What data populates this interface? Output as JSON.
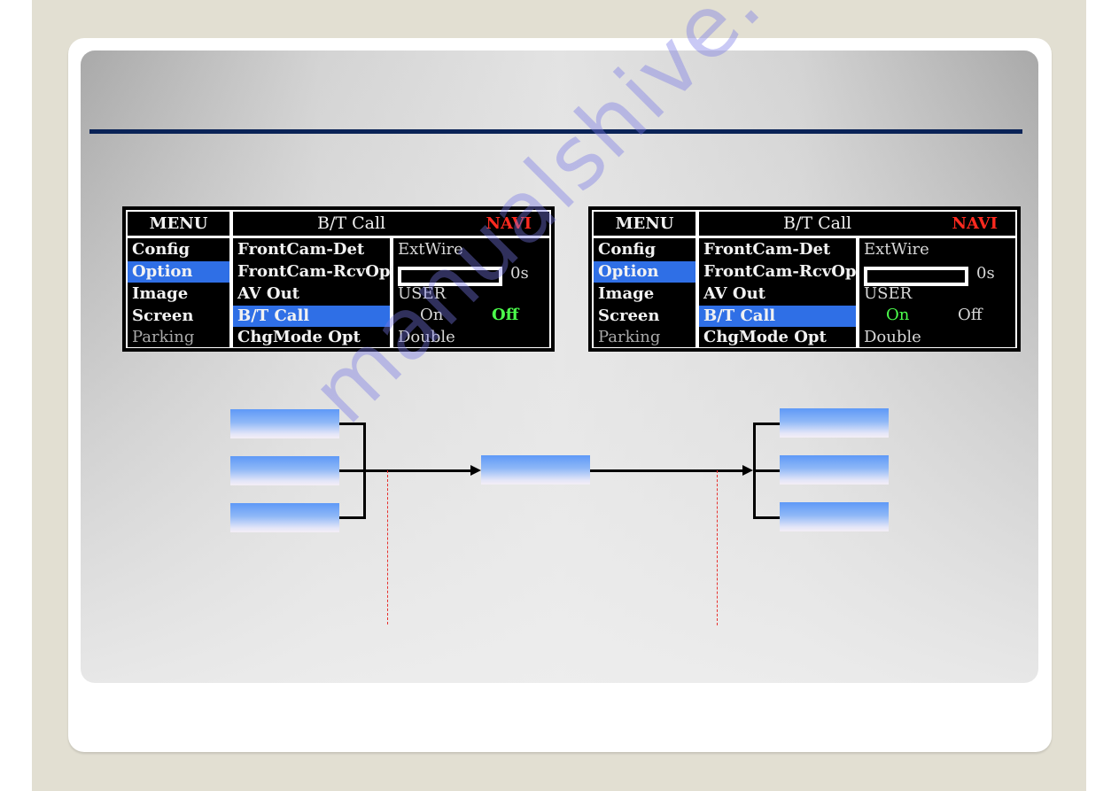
{
  "osd_left": {
    "header": {
      "menu": "MENU",
      "title": "B/T Call",
      "source": "NAVI"
    },
    "menu_items": [
      {
        "label": "Config",
        "state": "normal"
      },
      {
        "label": "Option",
        "state": "selected"
      },
      {
        "label": "Image",
        "state": "normal"
      },
      {
        "label": "Screen",
        "state": "normal"
      },
      {
        "label": "Parking",
        "state": "disabled"
      }
    ],
    "sub_items": [
      {
        "label": "FrontCam-Det",
        "state": "normal"
      },
      {
        "label": "FrontCam-RcvOpt",
        "state": "normal"
      },
      {
        "label": "AV Out",
        "state": "normal"
      },
      {
        "label": "B/T Call",
        "state": "selected"
      },
      {
        "label": "ChgMode Opt",
        "state": "normal"
      }
    ],
    "values": {
      "extwire": "ExtWire",
      "delay_value": "0s",
      "user": "USER",
      "option_on": "On",
      "option_off": "Off",
      "active_option": "Off",
      "double": "Double"
    }
  },
  "osd_right": {
    "header": {
      "menu": "MENU",
      "title": "B/T Call",
      "source": "NAVI"
    },
    "menu_items": [
      {
        "label": "Config",
        "state": "normal"
      },
      {
        "label": "Option",
        "state": "selected"
      },
      {
        "label": "Image",
        "state": "normal"
      },
      {
        "label": "Screen",
        "state": "normal"
      },
      {
        "label": "Parking",
        "state": "disabled"
      }
    ],
    "sub_items": [
      {
        "label": "FrontCam-Det",
        "state": "normal"
      },
      {
        "label": "FrontCam-RcvOpt",
        "state": "normal"
      },
      {
        "label": "AV Out",
        "state": "normal"
      },
      {
        "label": "B/T Call",
        "state": "selected"
      },
      {
        "label": "ChgMode Opt",
        "state": "normal"
      }
    ],
    "values": {
      "extwire": "ExtWire",
      "delay_value": "0s",
      "user": "USER",
      "option_on": "On",
      "option_off": "Off",
      "active_option": "On",
      "double": "Double"
    }
  },
  "diagram": {
    "left_boxes": [
      "",
      "",
      ""
    ],
    "center_box": "",
    "right_boxes": [
      "",
      "",
      ""
    ]
  },
  "watermark": "manualshive.com",
  "colors": {
    "accent_rule": "#0a2357",
    "selection": "#2f6fe6",
    "navi_red": "#ff2a1f",
    "active_green": "#4cff4c",
    "guide_red": "#e8302d"
  }
}
